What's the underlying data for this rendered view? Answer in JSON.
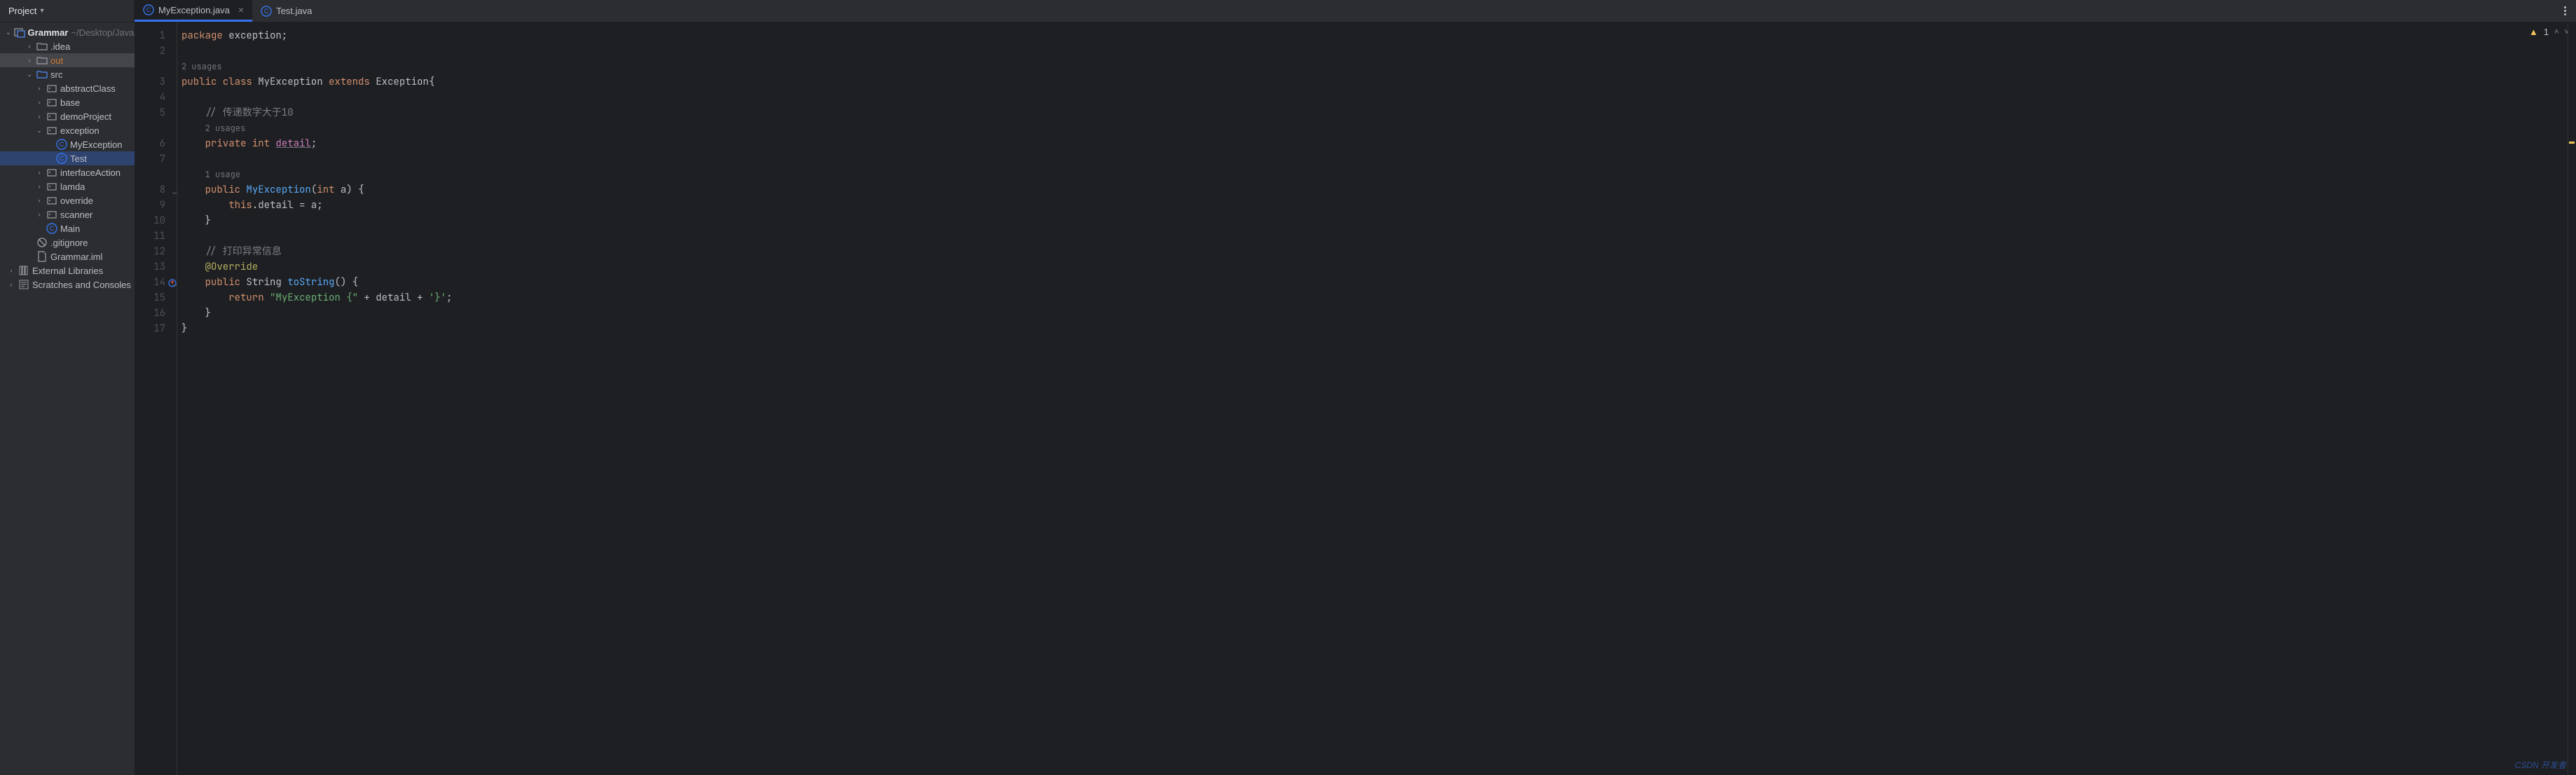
{
  "header": {
    "project_label": "Project"
  },
  "tabs": [
    {
      "label": "MyException.java",
      "active": true,
      "closeable": true
    },
    {
      "label": "Test.java",
      "active": false,
      "closeable": false
    }
  ],
  "inspection": {
    "warn_count": "1"
  },
  "tree": [
    {
      "depth": 0,
      "chev": "v",
      "icon": "project-icon",
      "label": "Grammar",
      "suffix": "~/Desktop/JavaC",
      "bold": true
    },
    {
      "depth": 1,
      "chev": ">",
      "icon": "folder-icon",
      "label": ".idea"
    },
    {
      "depth": 1,
      "chev": ">",
      "icon": "folder-icon",
      "label": "out",
      "orange": true,
      "highlighted": true
    },
    {
      "depth": 1,
      "chev": "v",
      "icon": "src-folder-icon",
      "label": "src"
    },
    {
      "depth": 2,
      "chev": ">",
      "icon": "package-icon",
      "label": "abstractClass"
    },
    {
      "depth": 2,
      "chev": ">",
      "icon": "package-icon",
      "label": "base"
    },
    {
      "depth": 2,
      "chev": ">",
      "icon": "package-icon",
      "label": "demoProject"
    },
    {
      "depth": 2,
      "chev": "v",
      "icon": "package-icon",
      "label": "exception"
    },
    {
      "depth": 3,
      "chev": "",
      "icon": "class-icon",
      "label": "MyException"
    },
    {
      "depth": 3,
      "chev": "",
      "icon": "class-icon",
      "label": "Test",
      "selected": true
    },
    {
      "depth": 2,
      "chev": ">",
      "icon": "package-icon",
      "label": "interfaceAction"
    },
    {
      "depth": 2,
      "chev": ">",
      "icon": "package-icon",
      "label": "lamda"
    },
    {
      "depth": 2,
      "chev": ">",
      "icon": "package-icon",
      "label": "override"
    },
    {
      "depth": 2,
      "chev": ">",
      "icon": "package-icon",
      "label": "scanner"
    },
    {
      "depth": 2,
      "chev": "",
      "icon": "class-icon",
      "label": "Main"
    },
    {
      "depth": 1,
      "chev": "",
      "icon": "gitignore-icon",
      "label": ".gitignore"
    },
    {
      "depth": 1,
      "chev": "",
      "icon": "file-icon",
      "label": "Grammar.iml"
    },
    {
      "depth": -1,
      "chev": ">",
      "icon": "lib-icon",
      "label": "External Libraries"
    },
    {
      "depth": -1,
      "chev": ">",
      "icon": "scratch-icon",
      "label": "Scratches and Consoles"
    }
  ],
  "gutter_lines": [
    "1",
    "2",
    "",
    "3",
    "4",
    "5",
    "",
    "6",
    "7",
    "",
    "8",
    "9",
    "10",
    "11",
    "12",
    "13",
    "14",
    "15",
    "16",
    "17"
  ],
  "fold_lines": [
    10,
    16
  ],
  "override_anno_line": 16,
  "usages": {
    "u1": "2 usages",
    "u2": "2 usages",
    "u3": "1 usage"
  },
  "code_tokens": {
    "l1": {
      "a": "package ",
      "b": "exception;"
    },
    "l3": {
      "a": "public class ",
      "b": "MyException ",
      "c": "extends ",
      "d": "Exception{"
    },
    "l5": {
      "a": "// 传递数字大于10"
    },
    "l6": {
      "a": "private int ",
      "b": "detail",
      "c": ";"
    },
    "l8": {
      "a": "public ",
      "b": "MyException",
      "c": "(",
      "d": "int ",
      "e": "a) {"
    },
    "l9": {
      "a": "this",
      "b": ".detail = a;"
    },
    "l10": {
      "a": "}"
    },
    "l12": {
      "a": "// 打印异常信息"
    },
    "l13": {
      "a": "@Override"
    },
    "l14": {
      "a": "public ",
      "b": "String ",
      "c": "toString",
      "d": "() {"
    },
    "l15": {
      "a": "return ",
      "b": "\"MyException {\" ",
      "c": "+ detail + ",
      "d": "'}'",
      "e": ";"
    },
    "l16": {
      "a": "}"
    },
    "l17": {
      "a": "}"
    }
  },
  "watermark": "CSDN 开发者"
}
